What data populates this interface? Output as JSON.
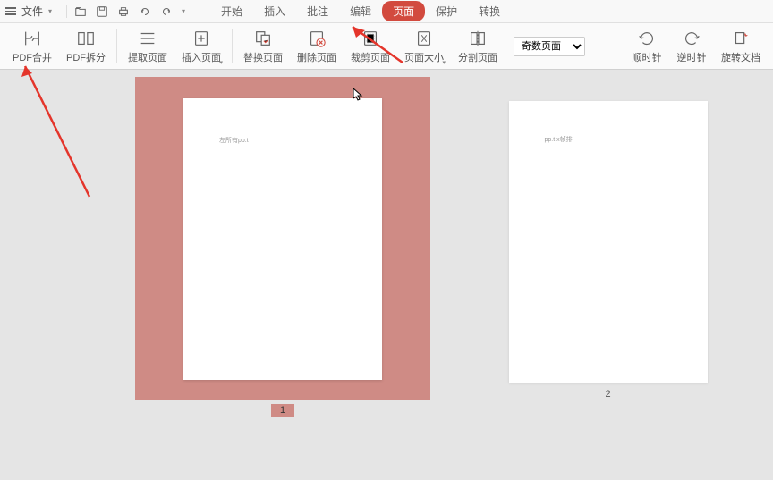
{
  "menu": {
    "file": "文件",
    "tabs": [
      "开始",
      "插入",
      "批注",
      "编辑",
      "页面",
      "保护",
      "转换"
    ],
    "active_tab": 4
  },
  "ribbon": {
    "items": [
      {
        "label": "PDF合并",
        "icon": "merge-icon"
      },
      {
        "label": "PDF拆分",
        "icon": "split-icon"
      },
      {
        "label": "提取页面",
        "icon": "extract-icon"
      },
      {
        "label": "插入页面",
        "icon": "insert-icon",
        "caret": true
      },
      {
        "label": "替换页面",
        "icon": "replace-icon"
      },
      {
        "label": "删除页面",
        "icon": "delete-icon"
      },
      {
        "label": "裁剪页面",
        "icon": "crop-icon"
      },
      {
        "label": "页面大小",
        "icon": "size-icon",
        "caret": true
      },
      {
        "label": "分割页面",
        "icon": "divide-icon"
      }
    ],
    "select_value": "奇数页面",
    "rotate_items": [
      {
        "label": "顺时针",
        "icon": "rotate-cw-icon"
      },
      {
        "label": "逆时针",
        "icon": "rotate-ccw-icon"
      },
      {
        "label": "旋转文档",
        "icon": "rotate-doc-icon"
      }
    ]
  },
  "pages": {
    "page1": {
      "num": "1",
      "text": "左所有pp.t"
    },
    "page2": {
      "num": "2",
      "text": "pp.t x帧排"
    }
  }
}
